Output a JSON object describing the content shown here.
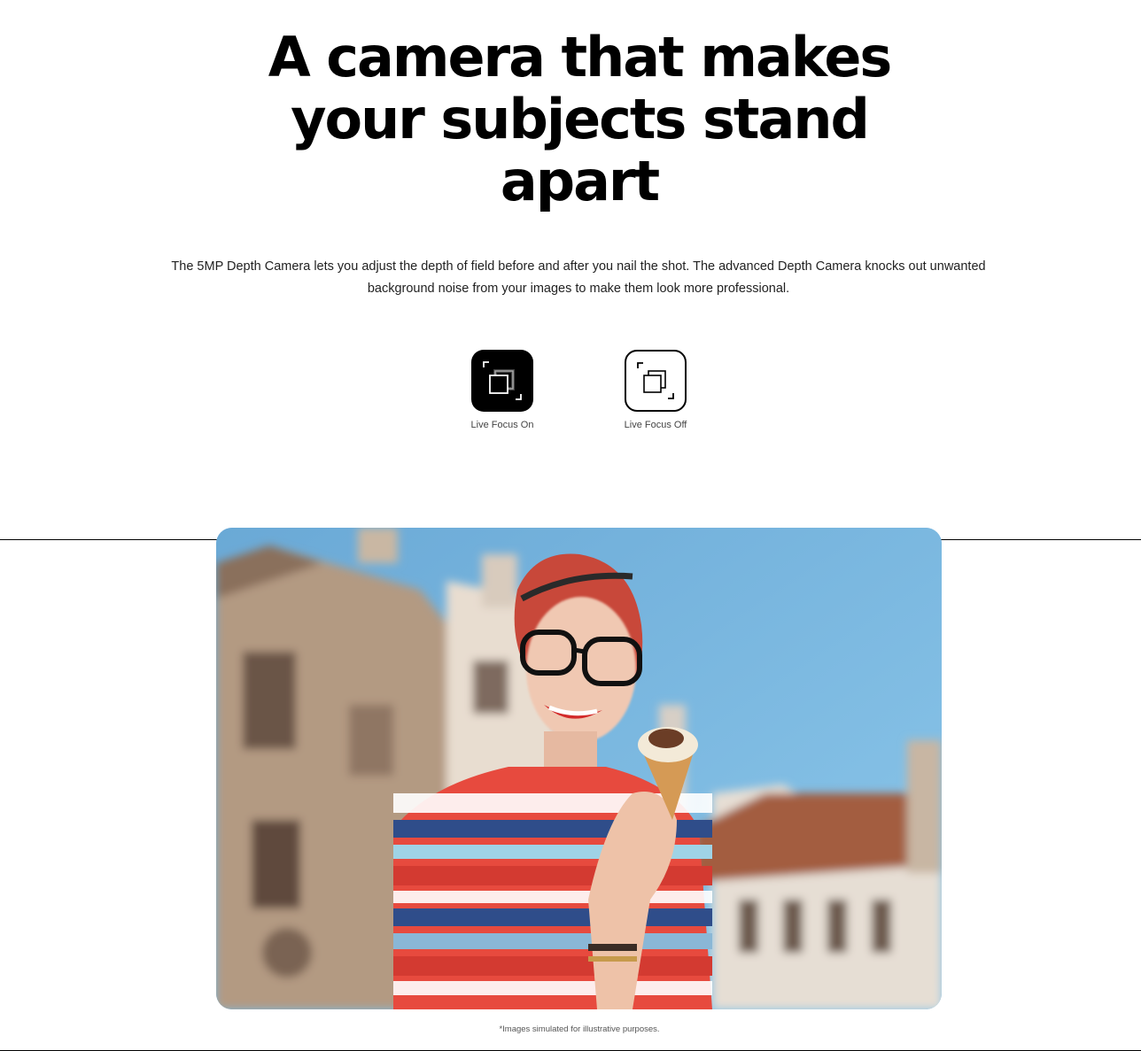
{
  "headline": {
    "line1": "A camera that makes",
    "line2": "your subjects stand",
    "line3": "apart"
  },
  "description": {
    "line1": "The 5MP Depth Camera lets you adjust the depth of field before and after you nail the shot. The advanced Depth Camera knocks out unwanted",
    "line2": "background noise from your images to make them look more professional."
  },
  "toggles": {
    "on": {
      "label": "Live Focus On",
      "icon": "live-focus-on-icon",
      "selected": true
    },
    "off": {
      "label": "Live Focus Off",
      "icon": "live-focus-off-icon",
      "selected": false
    }
  },
  "photo": {
    "subject": "woman-with-ice-cream-photo"
  },
  "disclaimer": "*Images simulated for illustrative purposes.",
  "colors": {
    "text": "#000000",
    "toggle_active_bg": "#000000",
    "toggle_inactive_bg": "#ffffff",
    "sky": "#7fb6dc"
  }
}
